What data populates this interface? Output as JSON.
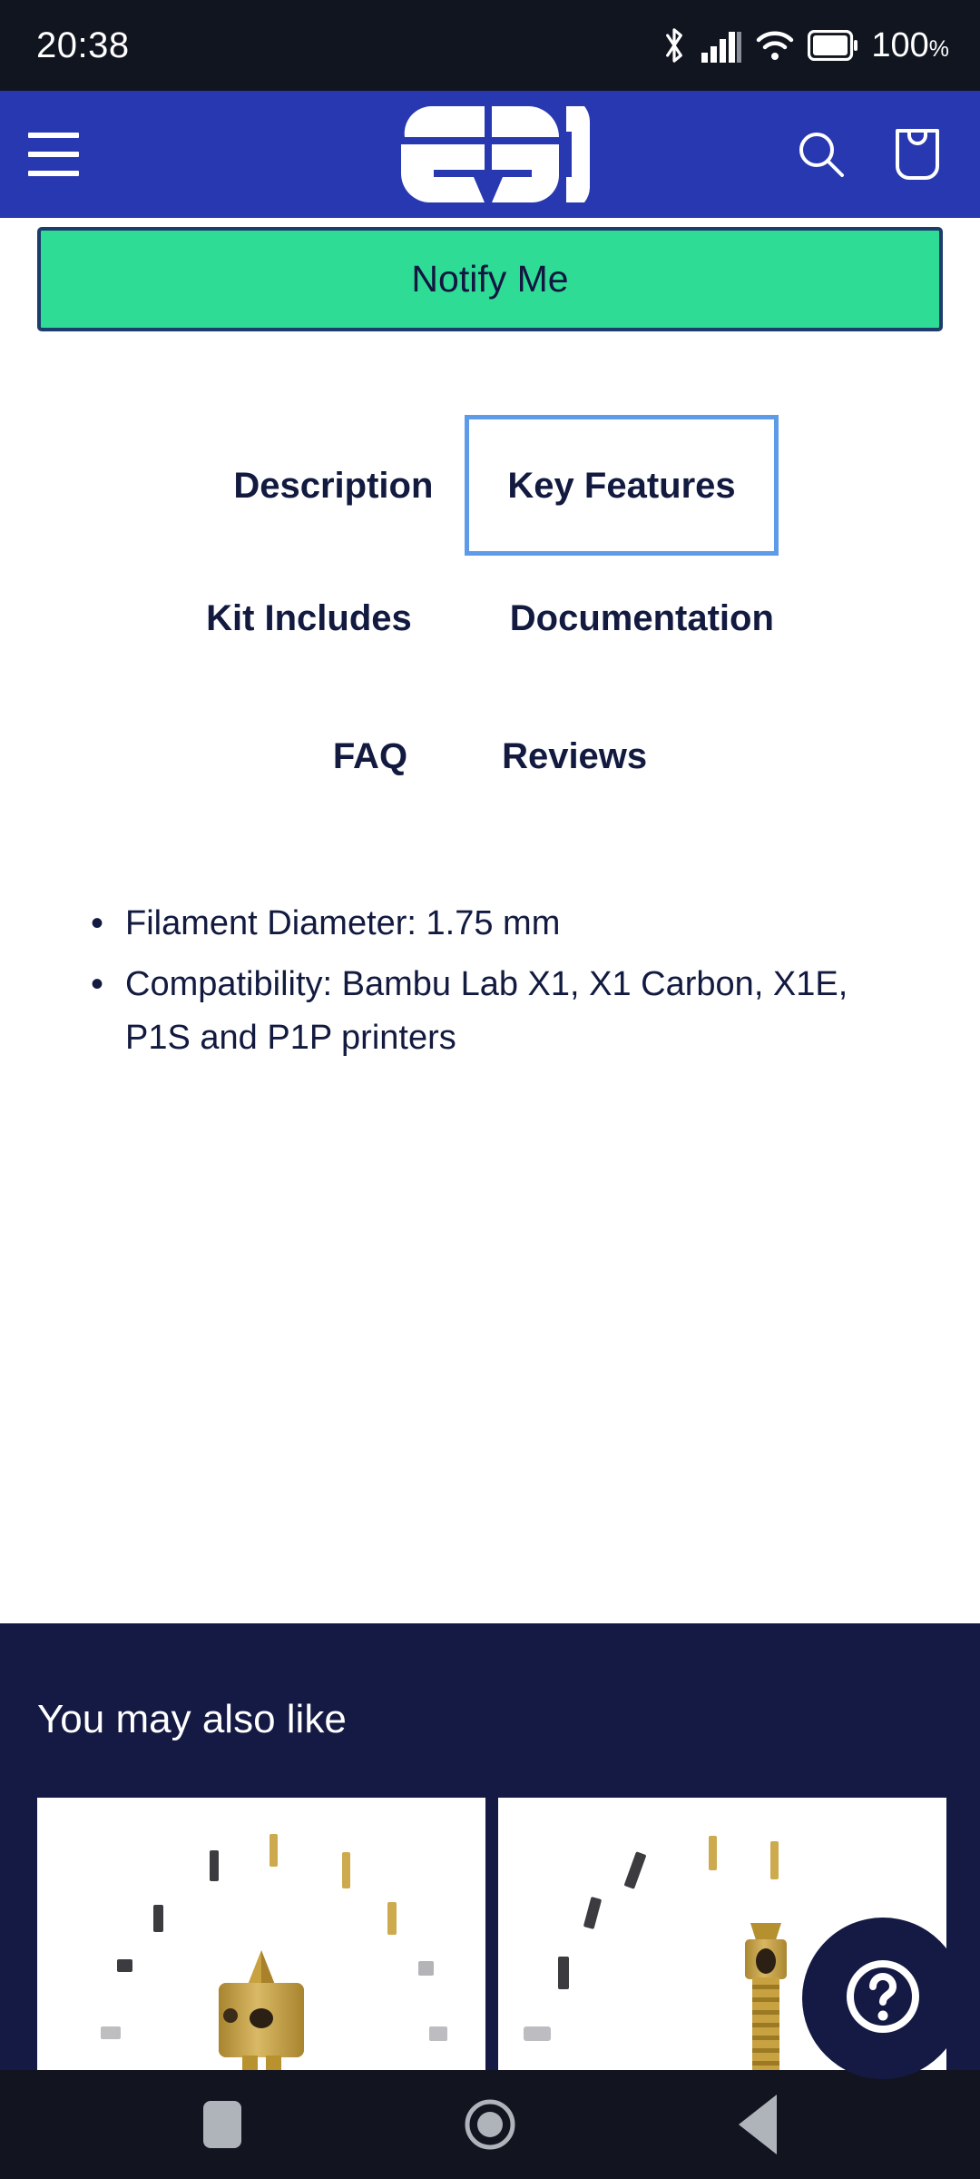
{
  "status_bar": {
    "time": "20:38",
    "battery_percent": "100",
    "percent_symbol": "%",
    "icons": [
      "bluetooth-icon",
      "cellular-signal-icon",
      "wifi-icon",
      "battery-icon"
    ]
  },
  "app_header": {
    "brand": "E3D",
    "menu_icon": "hamburger-menu-icon",
    "search_icon": "search-icon",
    "cart_icon": "shopping-bag-icon",
    "background_color": "#2838B0"
  },
  "product_actions": {
    "notify_label": "Notify Me",
    "notify_bg": "#2EDC95",
    "notify_border": "#1C3C6B",
    "notify_text_color": "#121640"
  },
  "tabs": {
    "selected": "Key Features",
    "focus_color": "#5D9BE8",
    "items": [
      {
        "label": "Description",
        "selected": false
      },
      {
        "label": "Key Features",
        "selected": true
      },
      {
        "label": "Kit Includes",
        "selected": false
      },
      {
        "label": "Documentation",
        "selected": false
      },
      {
        "label": "FAQ",
        "selected": false
      },
      {
        "label": "Reviews",
        "selected": false
      }
    ]
  },
  "key_features": {
    "bullets": [
      "Filament Diameter: 1.75 mm",
      "Compatibility: Bambu Lab X1, X1 Carbon, X1E, P1S and P1P printers"
    ]
  },
  "recommendations": {
    "title": "You may also like",
    "background_color": "#141A44",
    "cards": [
      {
        "image_alt": "brass-nozzle-with-hardware-photo"
      },
      {
        "image_alt": "brass-nozzle-threaded-with-hardware-photo"
      }
    ]
  },
  "help_fab": {
    "icon": "question-mark-circle-icon",
    "background_color": "#141A44"
  },
  "system_nav": {
    "recents_icon": "square-recents-icon",
    "home_icon": "circle-home-icon",
    "back_icon": "triangle-back-icon"
  }
}
